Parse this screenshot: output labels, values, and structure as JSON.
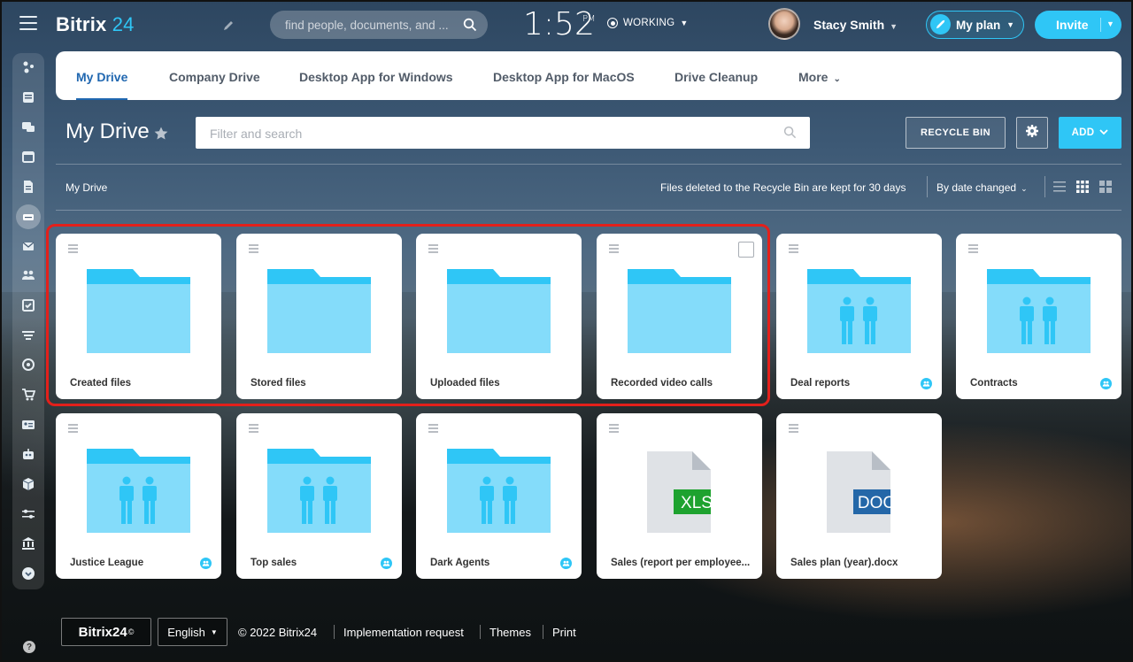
{
  "app": {
    "logo_text": "Bitrix",
    "logo_number": "24",
    "search_placeholder": "find people, documents, and ...",
    "clock_time": "1:52",
    "clock_ampm": "PM",
    "work_status": "WORKING",
    "user_name": "Stacy Smith",
    "plan_label": "My plan",
    "invite_label": "Invite"
  },
  "tabs": [
    {
      "label": "My Drive",
      "active": true
    },
    {
      "label": "Company Drive"
    },
    {
      "label": "Desktop App for Windows"
    },
    {
      "label": "Desktop App for MacOS"
    },
    {
      "label": "Drive Cleanup"
    },
    {
      "label": "More"
    }
  ],
  "toolbar": {
    "page_title": "My Drive",
    "filter_placeholder": "Filter and search",
    "recycle_bin_label": "RECYCLE BIN",
    "add_label": "ADD"
  },
  "subbar": {
    "breadcrumb": "My Drive",
    "recycle_note": "Files deleted to the Recycle Bin are kept for 30 days",
    "sort_label": "By date changed"
  },
  "items": [
    {
      "name": "Created files",
      "type": "folder",
      "shared": false
    },
    {
      "name": "Stored files",
      "type": "folder",
      "shared": false
    },
    {
      "name": "Uploaded files",
      "type": "folder",
      "shared": false
    },
    {
      "name": "Recorded video calls",
      "type": "folder",
      "shared": false,
      "checkbox": true
    },
    {
      "name": "Deal reports",
      "type": "group-folder",
      "shared": true
    },
    {
      "name": "Contracts",
      "type": "group-folder",
      "shared": true
    },
    {
      "name": "Justice League",
      "type": "group-folder",
      "shared": true
    },
    {
      "name": "Top sales",
      "type": "group-folder",
      "shared": true
    },
    {
      "name": "Dark Agents",
      "type": "group-folder",
      "shared": true
    },
    {
      "name": "Sales (report per employee...",
      "type": "file",
      "badge": "XLS",
      "badge_color": "#1ea22f"
    },
    {
      "name": "Sales plan (year).docx",
      "type": "file",
      "badge": "DOC",
      "badge_color": "#2467a8"
    }
  ],
  "footer": {
    "logo_text": "Bitrix24",
    "logo_mark": "©",
    "language": "English",
    "copyright": "© 2022 Bitrix24",
    "link_implementation": "Implementation request",
    "link_themes": "Themes",
    "link_print": "Print",
    "help_label": "?"
  },
  "colors": {
    "accent": "#2fc6f6",
    "tab_active": "#2067b0",
    "folder_back": "#2fc6f6",
    "folder_front": "#84dcfa",
    "highlight": "#e3201b"
  },
  "icons": [
    "menu-icon",
    "sites-icon",
    "feed-icon",
    "chat-icon",
    "calendar-icon",
    "documents-icon",
    "drive-icon",
    "mail-icon",
    "groups-icon",
    "tasks-icon",
    "filter-icon",
    "target-icon",
    "cart-icon",
    "contact-card-icon",
    "robot-icon",
    "box-icon",
    "sliders-icon",
    "bank-icon",
    "more-icon"
  ]
}
